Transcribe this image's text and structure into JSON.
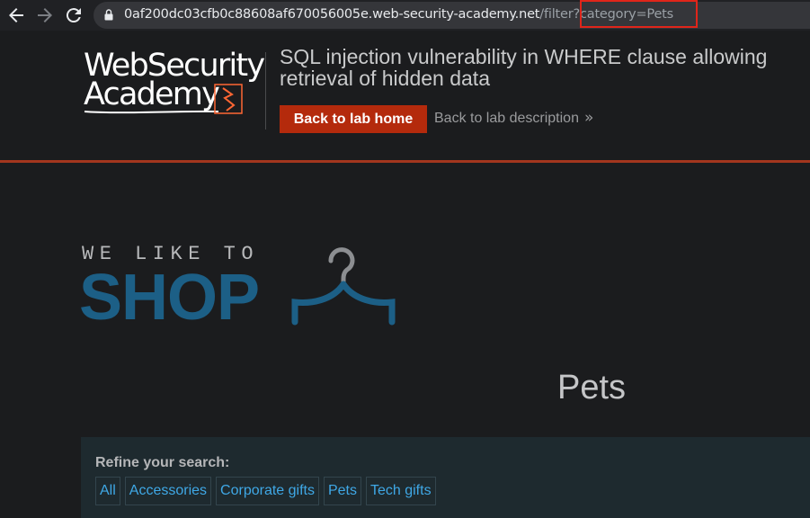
{
  "browser": {
    "back_icon": "arrow-left-icon",
    "forward_icon": "arrow-right-icon",
    "reload_icon": "reload-icon",
    "lock_icon": "lock-icon",
    "url_host": "0af200dc03cfb0c88608af670056005e.web-security-academy.net",
    "url_path": "/filter?category=Pets"
  },
  "lab_header": {
    "logo_line1": "WebSecurity",
    "logo_line2": "Academy",
    "title": "SQL injection vulnerability in WHERE clause allowing retrieval of hidden data",
    "back_home_label": "Back to lab home",
    "back_description_label": "Back to lab description",
    "chevron": "»",
    "accent_color": "#b42a0c"
  },
  "shop_logo": {
    "tagline": "WE LIKE TO",
    "word": "SHOP",
    "color": "#1c5f86"
  },
  "page": {
    "category_title": "Pets"
  },
  "filters": {
    "label": "Refine your search:",
    "items": [
      "All",
      "Accessories",
      "Corporate gifts",
      "Pets",
      "Tech gifts"
    ]
  }
}
